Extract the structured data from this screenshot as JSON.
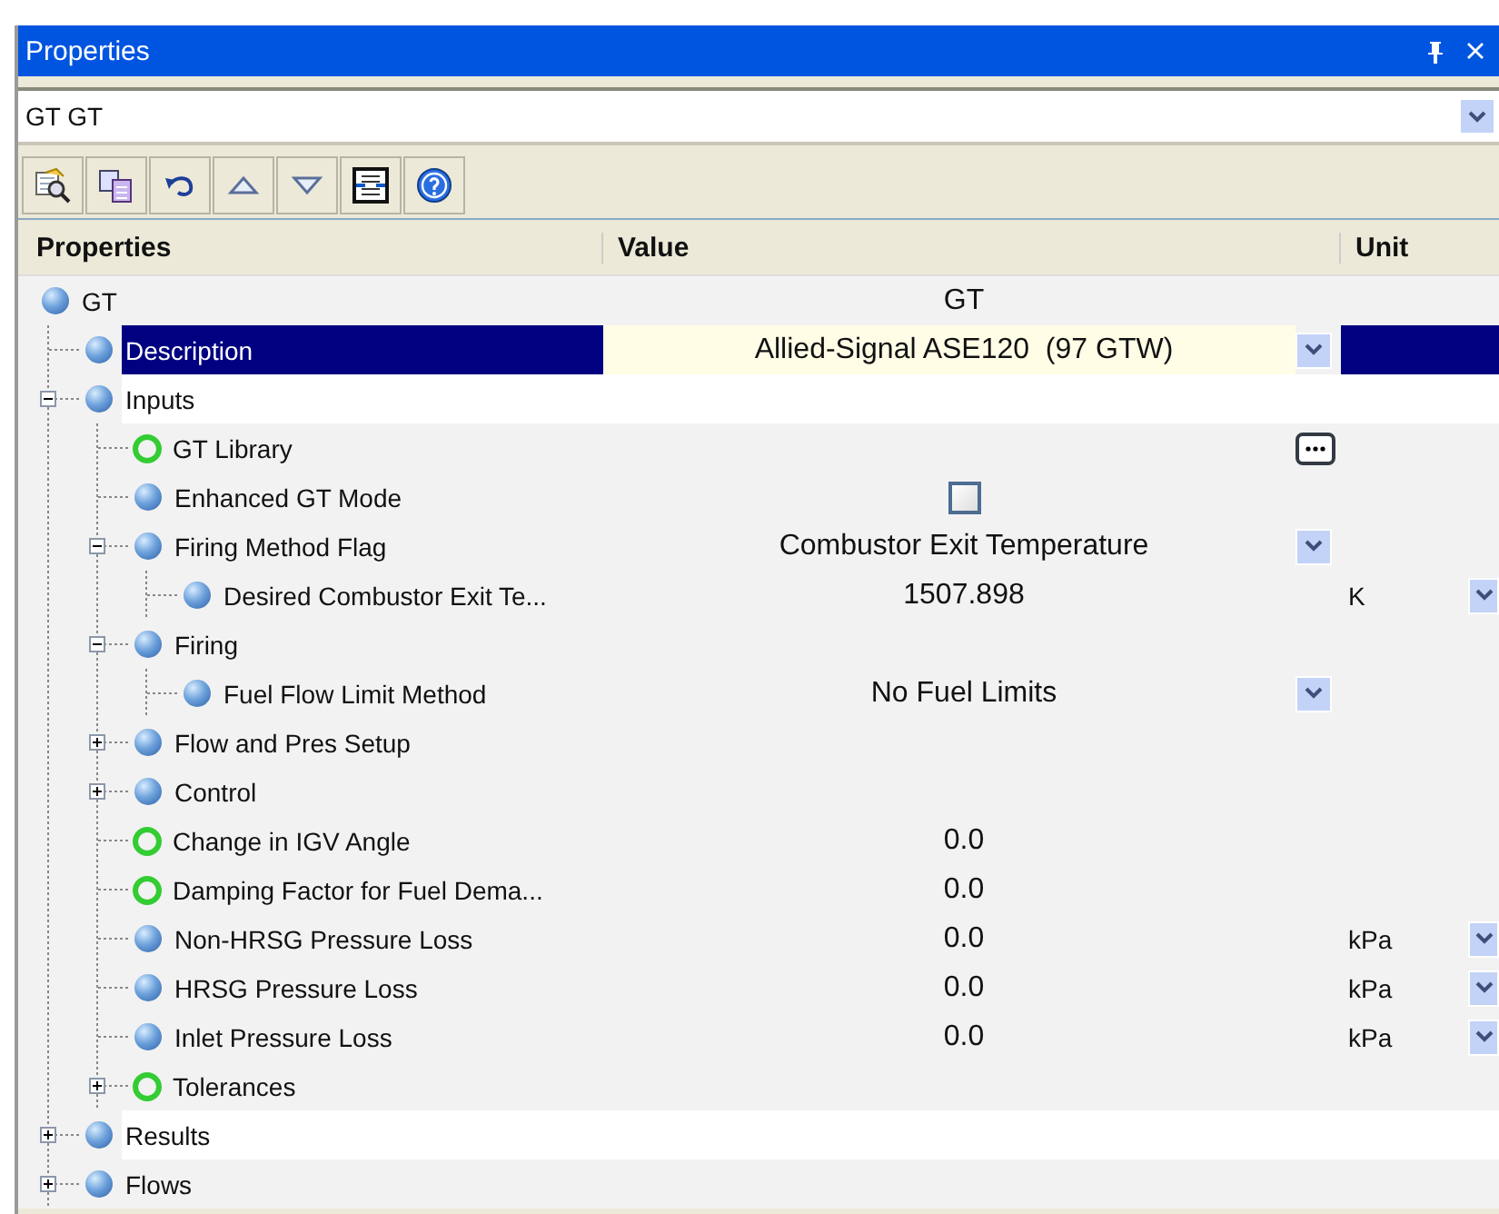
{
  "window": {
    "title": "Properties"
  },
  "object_selector": {
    "value": "GT GT"
  },
  "grid": {
    "columns": [
      "Properties",
      "Value",
      "Unit"
    ],
    "rows": [
      {
        "label": "GT",
        "kind": "value",
        "hollow_marker": false,
        "selected": false,
        "value": "GT",
        "children": [
          {
            "label": "Description",
            "kind": "dropdown",
            "hollow_marker": false,
            "selected": true,
            "value": "Allied-Signal ASE120  (97 GTW)"
          },
          {
            "label": "Inputs",
            "kind": "group",
            "hollow_marker": false,
            "selected": false,
            "highlighted": true,
            "expanded": true,
            "children": [
              {
                "label": "GT Library",
                "kind": "button",
                "hollow_marker": true,
                "selected": false
              },
              {
                "label": "Enhanced GT Mode",
                "kind": "checkbox",
                "hollow_marker": false,
                "selected": false,
                "checked": false
              },
              {
                "label": "Firing Method Flag",
                "kind": "dropdown",
                "hollow_marker": false,
                "selected": false,
                "expanded": true,
                "value": "Combustor Exit Temperature",
                "children": [
                  {
                    "label": "Desired Combustor Exit Te...",
                    "kind": "value",
                    "hollow_marker": false,
                    "selected": false,
                    "value": "1507.898",
                    "unit": "K",
                    "unit_dropdown": true
                  }
                ]
              },
              {
                "label": "Firing",
                "kind": "group",
                "hollow_marker": false,
                "selected": false,
                "expanded": true,
                "children": [
                  {
                    "label": "Fuel Flow Limit Method",
                    "kind": "dropdown",
                    "hollow_marker": false,
                    "selected": false,
                    "value": "No Fuel Limits"
                  }
                ]
              },
              {
                "label": "Flow and Pres Setup",
                "kind": "group",
                "hollow_marker": false,
                "selected": false,
                "expanded": false
              },
              {
                "label": "Control",
                "kind": "group",
                "hollow_marker": false,
                "selected": false,
                "expanded": false
              },
              {
                "label": "Change in IGV Angle",
                "kind": "value",
                "hollow_marker": true,
                "selected": false,
                "value": "0.0"
              },
              {
                "label": "Damping Factor for Fuel Dema...",
                "kind": "value",
                "hollow_marker": true,
                "selected": false,
                "value": "0.0"
              },
              {
                "label": "Non-HRSG Pressure Loss",
                "kind": "value",
                "hollow_marker": false,
                "selected": false,
                "value": "0.0",
                "unit": "kPa",
                "unit_dropdown": true
              },
              {
                "label": "HRSG Pressure Loss",
                "kind": "value",
                "hollow_marker": false,
                "selected": false,
                "value": "0.0",
                "unit": "kPa",
                "unit_dropdown": true
              },
              {
                "label": "Inlet Pressure Loss",
                "kind": "value",
                "hollow_marker": false,
                "selected": false,
                "value": "0.0",
                "unit": "kPa",
                "unit_dropdown": true
              },
              {
                "label": "Tolerances",
                "kind": "group",
                "hollow_marker": true,
                "selected": false,
                "expanded": false
              }
            ]
          },
          {
            "label": "Results",
            "kind": "group",
            "hollow_marker": false,
            "selected": false,
            "highlighted": true,
            "expanded": false
          },
          {
            "label": "Flows",
            "kind": "group",
            "hollow_marker": false,
            "selected": false,
            "expanded": false
          }
        ]
      }
    ]
  }
}
